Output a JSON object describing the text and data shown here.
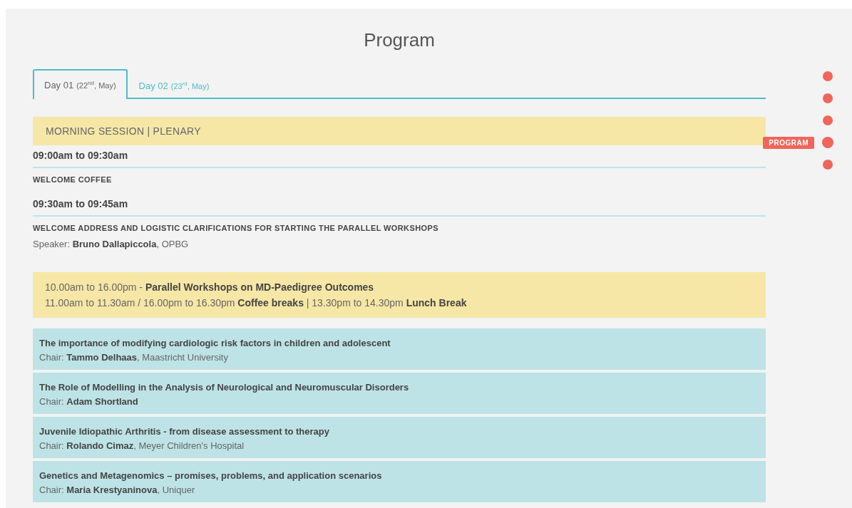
{
  "page": {
    "title": "Program"
  },
  "tabs": [
    {
      "label": "Day 01",
      "date": "(22$^{nd}$, May)",
      "selected": true
    },
    {
      "label": "Day 02",
      "date": "(23$^{rd}$, May)",
      "selected": false
    }
  ],
  "session_header": "MORNING SESSION | PLENARY",
  "slots": [
    {
      "time": "09:00am to 09:30am",
      "title": "WELCOME COFFEE"
    },
    {
      "time": "09:30am to 09:45am",
      "title": "WELCOME ADDRESS AND LOGISTIC CLARIFICATIONS FOR STARTING THE PARALLEL WORKSHOPS",
      "speaker": "Speaker: **Bruno Dallapiccola**, OPBG"
    }
  ],
  "banner": {
    "lines": [
      "10.00am to 16.00pm - **Parallel Workshops on MD-Paedigree Outcomes**",
      "11.00am to 11.30am / 16.00pm to 16.30pm **Coffee breaks** | 13.30pm to 14.30pm **Lunch Break**"
    ]
  },
  "workshops": [
    {
      "title": "The importance of modifying cardiologic risk factors in children and adolescent",
      "chair": "Chair: **Tammo Delhaas**, Maastricht University"
    },
    {
      "title": "The Role of Modelling in the Analysis of Neurological and Neuromuscular Disorders",
      "chair": "Chair: **Adam Shortland**"
    },
    {
      "title": "Juvenile Idiopathic Arthritis - from disease assessment to therapy",
      "chair": "Chair: **Rolando Cimaz**, Meyer Children's Hospital"
    },
    {
      "title": "Genetics and Metagenomics – promises, problems, and application scenarios",
      "chair": "Chair: **Maria Krestyaninova**, Uniquer"
    }
  ],
  "side_nav": [
    {
      "selected": false
    },
    {
      "selected": false
    },
    {
      "selected": false
    },
    {
      "selected": true,
      "label": "PROGRAM"
    },
    {
      "selected": false
    }
  ]
}
